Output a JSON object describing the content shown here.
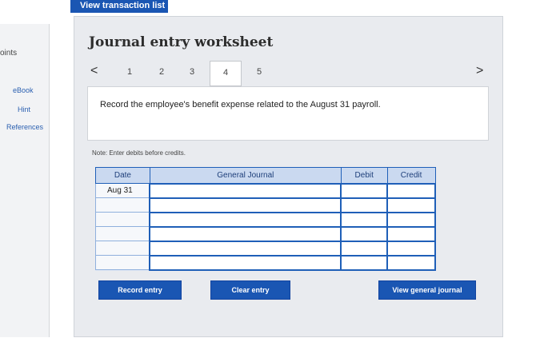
{
  "topbar": {
    "view_transaction_list": "View transaction list"
  },
  "left_rail": {
    "points_label": "oints",
    "links": [
      "eBook",
      "Hint",
      "References"
    ]
  },
  "worksheet": {
    "title": "Journal entry worksheet",
    "nav": {
      "prev": "<",
      "next": ">",
      "steps": [
        "1",
        "2",
        "3",
        "4",
        "5"
      ],
      "active_step": "4"
    },
    "prompt": "Record the employee's benefit expense related to the August 31 payroll.",
    "note": "Note: Enter debits before credits.",
    "table": {
      "headers": [
        "Date",
        "General Journal",
        "Debit",
        "Credit"
      ],
      "rows": [
        [
          "Aug 31",
          "",
          "",
          ""
        ],
        [
          "",
          "",
          "",
          ""
        ],
        [
          "",
          "",
          "",
          ""
        ],
        [
          "",
          "",
          "",
          ""
        ],
        [
          "",
          "",
          "",
          ""
        ],
        [
          "",
          "",
          "",
          ""
        ]
      ]
    },
    "buttons": {
      "record": "Record entry",
      "clear": "Clear entry",
      "view_journal": "View general journal"
    }
  }
}
